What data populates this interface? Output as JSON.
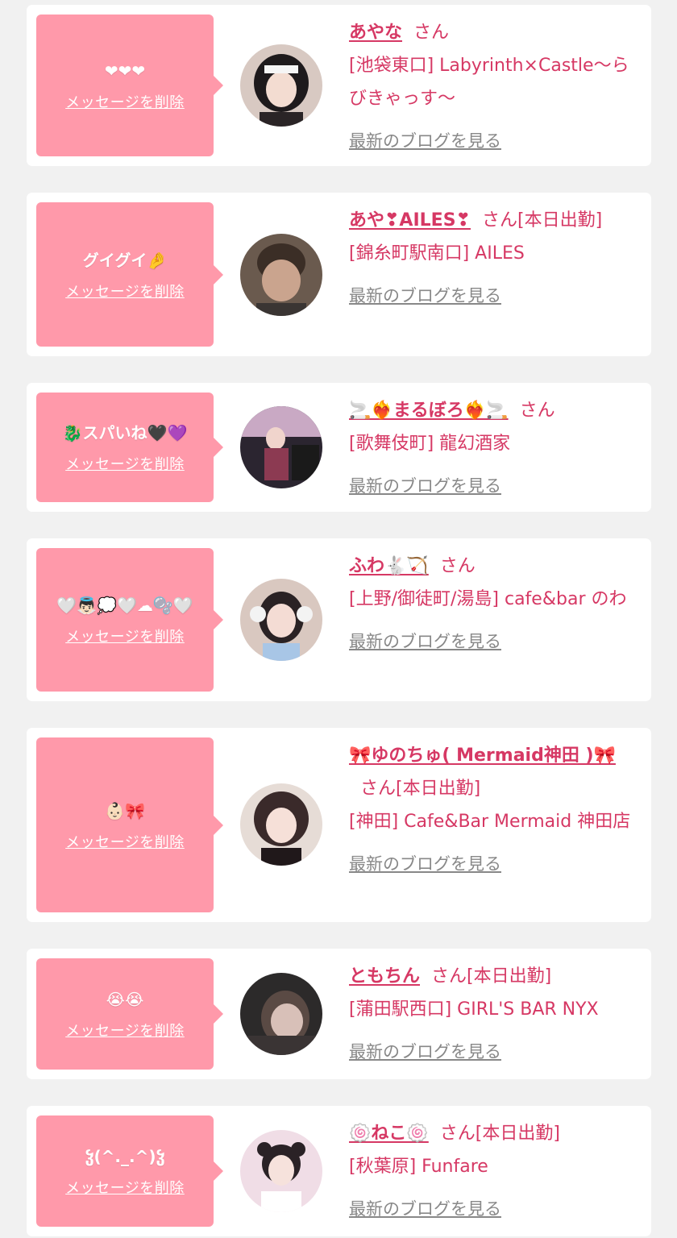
{
  "delete_label": "メッセージを削除",
  "blog_label": "最新のブログを見る",
  "colors": {
    "background": "#f1f1f1",
    "card": "#ffffff",
    "bubble": "#ff99aa",
    "accent_pink": "#d63864",
    "muted": "#888888"
  },
  "items": [
    {
      "name": "あやな",
      "suffix": "さん",
      "shop": "[池袋東口] Labyrinth×Castle〜らびきゃっす〜",
      "message": "❤❤❤",
      "avatar_icon": "avatar-photo"
    },
    {
      "name": "あや❣AILES❣",
      "suffix": "さん[本日出勤]",
      "shop": "[錦糸町駅南口] AILES",
      "message": "グイグイ🤌",
      "avatar_icon": "avatar-photo"
    },
    {
      "name": "🚬❤‍🔥まるぼろ❤‍🔥🚬",
      "suffix": "さん",
      "shop": "[歌舞伎町] 龍幻酒家",
      "message": "🐉スパいね🖤💜",
      "avatar_icon": "avatar-photo"
    },
    {
      "name": "ふわ🐇🏹",
      "suffix": "さん",
      "shop": "[上野/御徒町/湯島] cafe&bar のわ",
      "message": "🤍👼🏻💭🤍☁🫧🤍",
      "avatar_icon": "avatar-photo"
    },
    {
      "name": "🎀ゆのちゅ( Mermaid神田 )🎀",
      "suffix": "さん[本日出勤]",
      "shop": "[神田] Cafe&Bar Mermaid 神田店",
      "message": "👶🏻🎀",
      "avatar_icon": "avatar-photo"
    },
    {
      "name": "ともちん",
      "suffix": "さん[本日出勤]",
      "shop": "[蒲田駅西口] GIRL'S BAR NYX",
      "message": "😭😭",
      "avatar_icon": "avatar-photo"
    },
    {
      "name": "🍥ねこ🍥",
      "suffix": "さん[本日出勤]",
      "shop": "[秋葉原] Funfare",
      "message": "ჴ(^._.^)ჴ",
      "avatar_icon": "avatar-photo"
    }
  ]
}
